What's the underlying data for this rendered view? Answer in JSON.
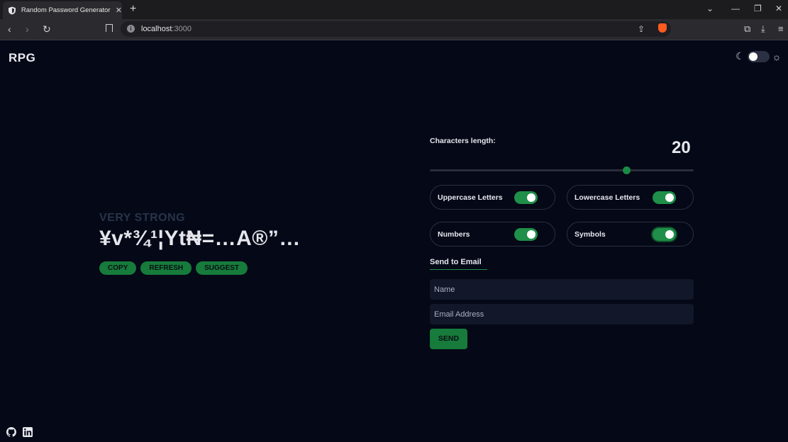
{
  "browser": {
    "tab_title": "Random Password Generator To",
    "url_host": "localhost",
    "url_port": ":3000"
  },
  "app": {
    "logo": "RPG",
    "strength": "VERY STRONG",
    "password": "¥v*¾¹¦Yt₦=…A®”…",
    "actions": {
      "copy": "COPY",
      "refresh": "REFRESH",
      "suggest": "SUGGEST"
    },
    "length": {
      "label": "Characters length:",
      "value": "20"
    },
    "options": {
      "uppercase": "Uppercase Letters",
      "lowercase": "Lowercase Letters",
      "numbers": "Numbers",
      "symbols": "Symbols"
    },
    "email": {
      "title": "Send to Email",
      "name_placeholder": "Name",
      "email_placeholder": "Email Address",
      "send": "SEND"
    }
  },
  "colors": {
    "background": "#050816",
    "accent": "#1f8f49"
  }
}
